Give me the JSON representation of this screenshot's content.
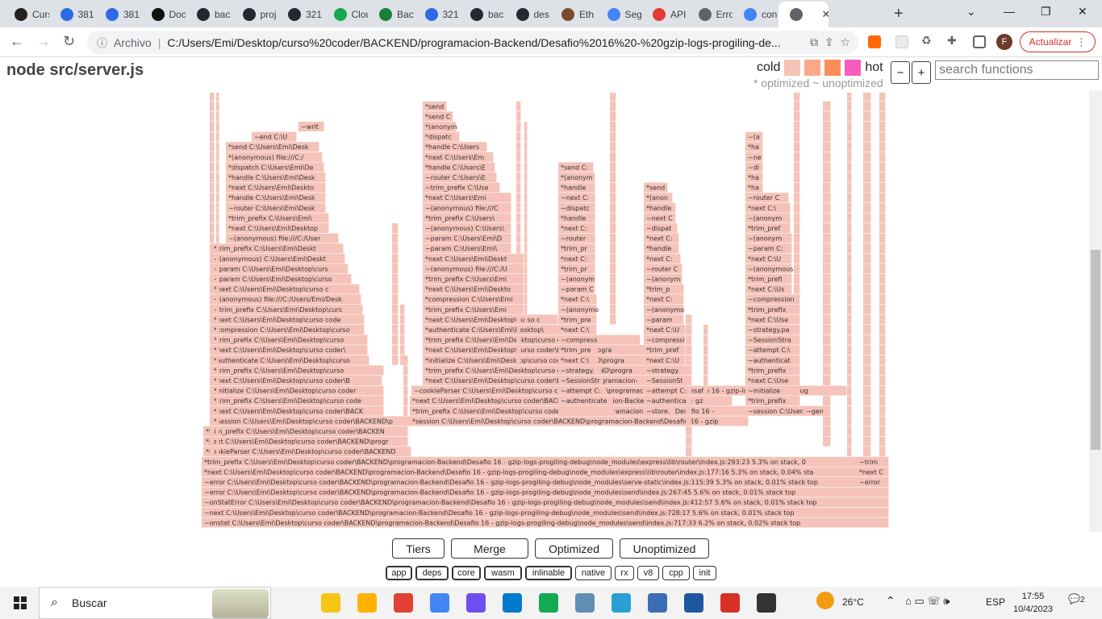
{
  "browser": {
    "tabs": [
      {
        "label": "Curs",
        "color": "#222"
      },
      {
        "label": "381",
        "color": "#2d6be4"
      },
      {
        "label": "381",
        "color": "#2d6be4"
      },
      {
        "label": "Doc",
        "color": "#111"
      },
      {
        "label": "bac",
        "color": "#24292f"
      },
      {
        "label": "proj",
        "color": "#24292f"
      },
      {
        "label": "321",
        "color": "#24292f"
      },
      {
        "label": "Clou",
        "color": "#13aa52"
      },
      {
        "label": "Bac",
        "color": "#188038"
      },
      {
        "label": "321",
        "color": "#2d6be4"
      },
      {
        "label": "bac",
        "color": "#24292f"
      },
      {
        "label": "des",
        "color": "#24292f"
      },
      {
        "label": "Eth",
        "color": "#7a4b2b"
      },
      {
        "label": "Seg",
        "color": "#4285f4"
      },
      {
        "label": "API",
        "color": "#e53935"
      },
      {
        "label": "Erro",
        "color": "#5f6368"
      },
      {
        "label": "con",
        "color": "#4285f4"
      },
      {
        "label": "",
        "color": "#5f6368"
      }
    ],
    "active_tab_close": "✕",
    "new_tab": "+",
    "win_controls": [
      "⌄",
      "—",
      "❐",
      "✕"
    ],
    "omnibox": {
      "scheme_label": "Archivo",
      "url": "C:/Users/Emi/Desktop/curso%20coder/BACKEND/programacion-Backend/Desafio%2016%20-%20gzip-logs-progiling-de..."
    },
    "profile_initial": "F",
    "update_label": "Actualizar"
  },
  "flamegraph": {
    "title": "node src/server.js",
    "legend": {
      "cold": "cold",
      "hot": "hot",
      "colors": [
        "#f7c3b5",
        "#f9a889",
        "#fb8d5a",
        "#f75dbd"
      ],
      "sub": "* optimized ~ unoptimized"
    },
    "zoom_out": "−",
    "zoom_in": "+",
    "search_placeholder": "search functions",
    "buttons": [
      "Tiers",
      "Merge",
      "Optimized",
      "Unoptimized"
    ],
    "chips": [
      "app",
      "deps",
      "core",
      "wasm",
      "inlinable",
      "native",
      "rx",
      "v8",
      "cpp",
      "init"
    ],
    "frame_color": "#f5c3b9",
    "frames_bottom_up": [
      "~onstat C:\\Users\\Emi\\Desktop\\curso coder\\BACKEND\\programacion-Backend\\Desafio 16 - gzip-logs-progiling-debug\\node_modules\\send\\index.js:717:33 6.2% on stack, 0.02% stack top",
      "~next C:\\Users\\Emi\\Desktop\\curso coder\\BACKEND\\programacion-Backend\\Desafio 16 - gzip-logs-progiling-debug\\node_modules\\send\\index.js:728:17 5.6% on stack, 0.01% stack top",
      "~onStatError C:\\Users\\Emi\\Desktop\\curso coder\\BACKEND\\programacion-Backend\\Desafio 16 - gzip-logs-progiling-debug\\node_modules\\send\\index.js:412:57 5.6% on stack, 0.01% stack top",
      "~error C:\\Users\\Emi\\Desktop\\curso coder\\BACKEND\\programacion-Backend\\Desafio 16 - gzip-logs-progiling-debug\\node_modules\\send\\index.js:267:45 5.6% on stack, 0.01% stack top",
      "~error C:\\Users\\Emi\\Desktop\\curso coder\\BACKEND\\programacion-Backend\\Desafio 16 - gzip-logs-progiling-debug\\node_modules\\serve-static\\index.js:115:39 5.3% on stack, 0.01% stack top",
      "*next C:\\Users\\Emi\\Desktop\\curso coder\\BACKEND\\programacion-Backend\\Desafio 16 - gzip-logs-progiling-debug\\node_modules\\express\\lib\\router\\index.js:177:16 5.3% on stack, 0.04% sta",
      "*trim_prefix C:\\Users\\Emi\\Desktop\\curso coder\\BACKEND\\programacion-Backend\\Desafio 16 - gzip-logs-progiling-debug\\node_modules\\express\\lib\\router\\index.js:293:23 5.3% on stack, 0",
      "*cookieParser C:\\Users\\Emi\\Desktop\\curso coder\\BACKEND",
      "*next C:\\Users\\Emi\\Desktop\\curso coder\\BACKEND\\progra",
      "*trim_prefix C:\\Users\\Emi\\Desktop\\curso coder\\BACKEND",
      "*session C:\\Users\\Emi\\Desktop\\curso coder\\BACKEND\\pr",
      "*next C:\\Users\\Emi\\Desktop\\curso coder\\BACK",
      "*trim_prefix C:\\Users\\Emi\\Desktop\\curso coder",
      "*initialize C:\\Users\\Emi\\Desktop\\curso coder\\B",
      "*next C:\\Users\\Emi\\Desktop\\curso coder\\B",
      "*trim_prefix C:\\Users\\Emi\\Desktop\\curso",
      "*authenticate C:\\Users\\Emi\\Desktop\\curso",
      "*next C:\\Users\\Emi\\Desktop\\curso coder\\",
      "*trim_prefix C:\\Users\\Emi\\Desktop\\curso",
      "*compression C:\\Users\\Emi\\Desktop\\curso",
      "*next C:\\Users\\Emi\\Desktop\\curso code",
      "~trim_prefix C:\\Users\\Emi\\Desktop\\curs",
      "~(anonymous) file:///C:/Users/Emi/Desk",
      "*next C:\\Users\\Emi\\Desktop\\curso c",
      "~param C:\\Users\\Emi\\Desktop\\curso",
      "~param C:\\Users\\Emi\\Desktop\\curs",
      "~(anonymous) C:\\Users\\Emi\\Deskt",
      "*trim_prefix C:\\Users\\Emi\\Deskt"
    ],
    "tower_a": [
      "~(anonymous) file:///C:/Users/E",
      "*next C:\\Users\\Emi\\Desktop\\",
      "*trim_prefix C:\\Users\\Emi\\De",
      "~router C:\\Users\\Emi\\Deskt",
      "*handle C:\\Users\\Emi\\Deskto",
      "*next C:\\Users\\Emi\\Desktop\\",
      "*handle C:\\Users\\Emi\\Deskt",
      "*dispatch C:\\Users\\Emi\\Desk",
      "*(anonymous) file:///C:/Use",
      "*send C:\\Users\\Emi\\Desk",
      "~end C:\\U",
      "~write"
    ],
    "tower_b": [
      "*session C:\\Users\\Emi\\Desktop\\curso coder\\BACKEND\\programacion-Backend\\Desafio 16 - gzip",
      "*trim_prefix C:\\Users\\Emi\\Desktop\\curso coder\\BACKEND\\programacion-Backend\\Desafio 16 - gzip-logs-progiling-debug\\",
      "*next C:\\Users\\Emi\\Desktop\\curso coder\\BACKEND\\programacion-Backend\\Desafio 16 - gzip-logs-progiling-debug\\node_",
      "~cookieParser C:\\Users\\Emi\\Desktop\\curso coder\\BACKEND\\programacion-Backend\\Desafio 16 - gzip-logs-progiling-debug\\node",
      "*next C:\\Users\\Emi\\Desktop\\curso coder\\BACKEND\\programacion-Backend\\De",
      "*trim_prefix C:\\Users\\Emi\\Desktop\\curso coder\\BACKEND\\programacion-Back",
      "*initialize C:\\Users\\Emi\\Desktop\\curso coder\\BACKEND\\programacion",
      "*next C:\\Users\\Emi\\Desktop\\curso coder\\BACKEND\\progra",
      "*trim_prefix C:\\Users\\Emi\\Desktop\\curso coder\\BACK",
      "*authenticate C:\\Users\\Emi\\Desktop\\c",
      "*next C:\\Users\\Emi\\Desktop\\curso co",
      "*trim_prefix C:\\Users\\Emi\\Desktop",
      "*compression C:\\Users\\Emi\\De",
      "*next C:\\Users\\Emi\\Desktop",
      "*trim_prefix C:\\Users\\Emi\\De",
      "~(anonymous) file:///C:/Users",
      "*next C:\\Users\\Emi\\Deskt",
      "~param C:\\Users\\Emi\\",
      "~param C:\\Users\\Emi\\D",
      "~(anonymous) C:\\Users\\",
      "*trim_prefix C:\\Users\\",
      "~(anonymous) file:///C",
      "*next C:\\Users\\Emi",
      "~trim_prefix C:\\Use",
      "~router C:\\Users\\E",
      "*handle C:\\Users\\E",
      "*next C:\\Users\\Em",
      "*handle C:\\Users",
      "*dispatch C",
      "*(anonymous",
      "*send C:",
      "*send"
    ],
    "tower_c": [
      "*next C:\\Users\\Emi\\Desktop\\curso coder\\BACKEND\\progra",
      "~authenticate C",
      "~attempt C:\\U",
      "~SessionStrat",
      "~strategy.pass",
      "*next C:\\Use",
      "*trim_prefix C",
      "~compression",
      "*next C:\\Use",
      "*trim_prefix C",
      "~(anonymous",
      "*next C:\\Use",
      "~param C:\\U",
      "~(anonymous)",
      "*trim_prefix",
      "*next C:\\Us",
      "*trim_prefix",
      "~router C:\\",
      "*next C:\\Us",
      "*handle C:",
      "~dispatch",
      "~next C:\\U",
      "*handle C:",
      "*(anonym",
      "*send C:\\"
    ],
    "tower_d": [
      "~store.",
      "~authenticate",
      "~attempt C:",
      "~SessionStra",
      "~strategy.pa",
      "*next C:\\Us",
      "*trim_prefix",
      "~compression",
      "*next C:\\Us",
      "~param",
      "~(anonymous",
      "*next C:",
      "*trim_p",
      "~(anonym",
      "~router C",
      "*next C:",
      "*handle",
      "*next C:",
      "~dispat",
      "~next C",
      "*handle",
      "*(anon",
      "*send"
    ],
    "tower_e": [
      "~session C:\\Users\\Emi\\D",
      "*trim_prefix C:\\Us",
      "~initialize C:\\Us",
      "*next C:\\Users",
      "*trim_prefix C:",
      "~authenticate",
      "~attempt C:\\U",
      "~SessionStrat",
      "~strategy.pass",
      "*next C:\\Users",
      "*trim_prefix",
      "~compression",
      "*next C:\\User",
      "*trim_prefix C",
      "~(anonymous",
      "*next C:\\U",
      "~param C:",
      "~(anonym",
      "*trim_pref",
      "~(anonym",
      "*next C:\\",
      "~router C",
      "*han",
      "*han",
      "~disp",
      "~nex",
      "*han",
      "~(an"
    ],
    "tower_f": [
      "~error C",
      "*next C",
      "~trim"
    ],
    "tower_g": [
      "~gene"
    ]
  },
  "taskbar": {
    "search_label": "Buscar",
    "weather": "26°C",
    "lang": "ESP",
    "time": "17:55",
    "date": "10/4/2023",
    "notif_count": "2",
    "apps": [
      "#f5c518",
      "#ffb300",
      "#e34133",
      "#4285f4",
      "#6e4ef0",
      "#007acc",
      "#13aa52",
      "#5f8fb6",
      "#2a9fd6",
      "#3a6db5",
      "#1e56a0",
      "#d93025",
      "#333"
    ]
  }
}
